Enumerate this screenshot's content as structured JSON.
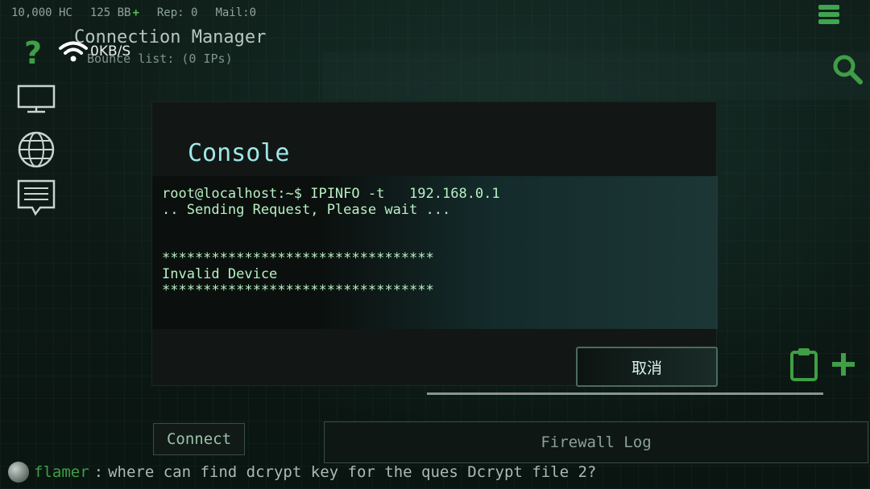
{
  "status": {
    "hc": "10,000 HC",
    "bb": "125 BB",
    "bb_plus": "+",
    "rep": "Rep: 0",
    "mail": "Mail:0"
  },
  "connection_manager": {
    "title": "Connection Manager",
    "bounce_list": "Bounce list: (0 IPs)",
    "speed": "0KB/S"
  },
  "help": {
    "glyph": "?"
  },
  "dialog": {
    "title": "Console",
    "lines": [
      "root@localhost:~$ IPINFO -t   192.168.0.1",
      ".. Sending Request, Please wait ...",
      "",
      "*********************************",
      "Invalid Device",
      "*********************************"
    ],
    "cancel_label": "取消"
  },
  "buttons": {
    "connect": "Connect",
    "firewall_log": "Firewall Log"
  },
  "chat": {
    "user": "flamer",
    "separator": ":",
    "message": "where can find dcrypt key for the ques Dcrypt file 2?"
  },
  "colors": {
    "accent_green": "#3f9e46",
    "console_text": "#b9f0c4",
    "dialog_title": "#9ee8e8"
  }
}
